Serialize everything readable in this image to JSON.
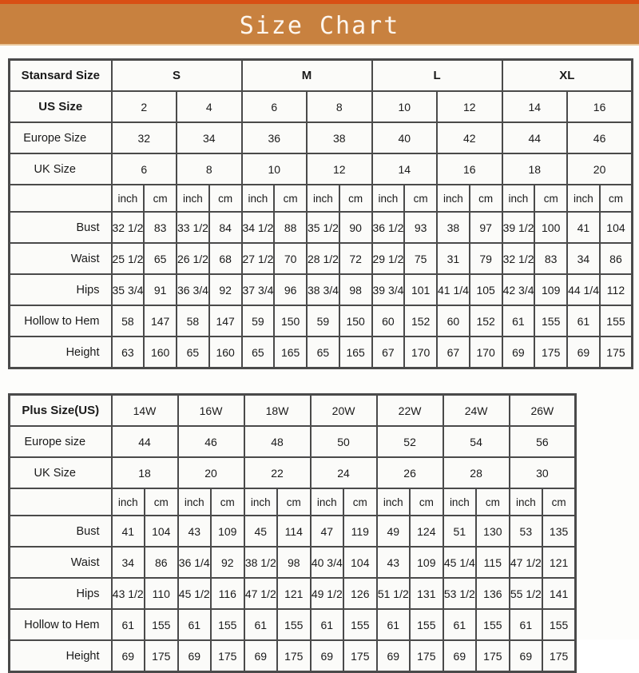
{
  "banner": {
    "title": "Size Chart",
    "bg_color": "#c8813f",
    "stripe_color": "#d94f14",
    "text_color": "#fdf6ee"
  },
  "standard_table": {
    "corner_label": "Stansard Size",
    "row_labels": {
      "us": "US Size",
      "europe": "Europe Size",
      "uk": "UK Size",
      "bust": "Bust",
      "waist": "Waist",
      "hips": "Hips",
      "hollow": "Hollow to Hem",
      "height": "Height"
    },
    "groups": [
      "S",
      "M",
      "L",
      "XL"
    ],
    "us_sizes": [
      "2",
      "4",
      "6",
      "8",
      "10",
      "12",
      "14",
      "16"
    ],
    "europe_sizes": [
      "32",
      "34",
      "36",
      "38",
      "40",
      "42",
      "44",
      "46"
    ],
    "uk_sizes": [
      "6",
      "8",
      "10",
      "12",
      "14",
      "16",
      "18",
      "20"
    ],
    "unit_inch": "inch",
    "unit_cm": "cm",
    "bust": [
      "32 1/2",
      "83",
      "33 1/2",
      "84",
      "34 1/2",
      "88",
      "35 1/2",
      "90",
      "36 1/2",
      "93",
      "38",
      "97",
      "39 1/2",
      "100",
      "41",
      "104"
    ],
    "waist": [
      "25 1/2",
      "65",
      "26 1/2",
      "68",
      "27 1/2",
      "70",
      "28 1/2",
      "72",
      "29 1/2",
      "75",
      "31",
      "79",
      "32 1/2",
      "83",
      "34",
      "86"
    ],
    "hips": [
      "35 3/4",
      "91",
      "36 3/4",
      "92",
      "37 3/4",
      "96",
      "38 3/4",
      "98",
      "39 3/4",
      "101",
      "41 1/4",
      "105",
      "42 3/4",
      "109",
      "44 1/4",
      "112"
    ],
    "hollow": [
      "58",
      "147",
      "58",
      "147",
      "59",
      "150",
      "59",
      "150",
      "60",
      "152",
      "60",
      "152",
      "61",
      "155",
      "61",
      "155"
    ],
    "height": [
      "63",
      "160",
      "65",
      "160",
      "65",
      "165",
      "65",
      "165",
      "67",
      "170",
      "67",
      "170",
      "69",
      "175",
      "69",
      "175"
    ]
  },
  "plus_table": {
    "corner_label": "Plus Size(US)",
    "row_labels": {
      "europe": "Europe size",
      "uk": "UK Size",
      "bust": "Bust",
      "waist": "Waist",
      "hips": "Hips",
      "hollow": "Hollow to Hem",
      "height": "Height"
    },
    "plus_sizes": [
      "14W",
      "16W",
      "18W",
      "20W",
      "22W",
      "24W",
      "26W"
    ],
    "europe_sizes": [
      "44",
      "46",
      "48",
      "50",
      "52",
      "54",
      "56"
    ],
    "uk_sizes": [
      "18",
      "20",
      "22",
      "24",
      "26",
      "28",
      "30"
    ],
    "unit_inch": "inch",
    "unit_cm": "cm",
    "bust": [
      "41",
      "104",
      "43",
      "109",
      "45",
      "114",
      "47",
      "119",
      "49",
      "124",
      "51",
      "130",
      "53",
      "135"
    ],
    "waist": [
      "34",
      "86",
      "36 1/4",
      "92",
      "38 1/2",
      "98",
      "40 3/4",
      "104",
      "43",
      "109",
      "45 1/4",
      "115",
      "47 1/2",
      "121"
    ],
    "hips": [
      "43 1/2",
      "110",
      "45 1/2",
      "116",
      "47 1/2",
      "121",
      "49 1/2",
      "126",
      "51 1/2",
      "131",
      "53 1/2",
      "136",
      "55 1/2",
      "141"
    ],
    "hollow": [
      "61",
      "155",
      "61",
      "155",
      "61",
      "155",
      "61",
      "155",
      "61",
      "155",
      "61",
      "155",
      "61",
      "155"
    ],
    "height": [
      "69",
      "175",
      "69",
      "175",
      "69",
      "175",
      "69",
      "175",
      "69",
      "175",
      "69",
      "175",
      "69",
      "175"
    ]
  }
}
